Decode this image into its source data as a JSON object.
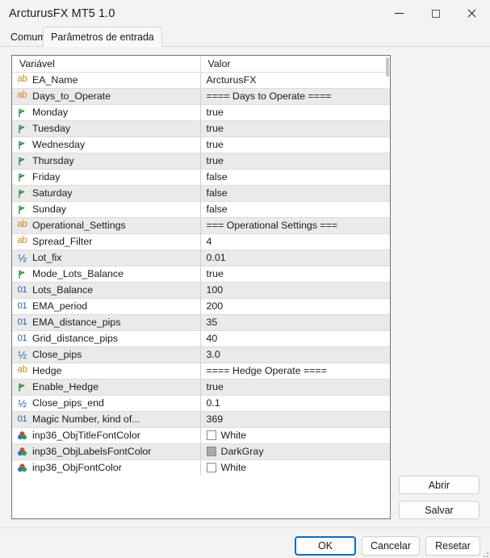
{
  "window": {
    "title": "ArcturusFX MT5 1.0",
    "controls": [
      {
        "name": "minimize",
        "glyph": "minimize-icon"
      },
      {
        "name": "maximize",
        "glyph": "maximize-icon"
      },
      {
        "name": "close",
        "glyph": "close-icon"
      }
    ]
  },
  "tabs": [
    {
      "label": "Comum",
      "active": false
    },
    {
      "label": "Parâmetros de entrada",
      "active": true
    }
  ],
  "table": {
    "headers": {
      "variable": "Variável",
      "value": "Valor"
    },
    "rows": [
      {
        "icon": "string-type-icon",
        "name": "EA_Name",
        "value": "ArcturusFX"
      },
      {
        "icon": "string-type-icon",
        "name": "Days_to_Operate",
        "value": "==== Days to Operate ===="
      },
      {
        "icon": "bool-type-icon",
        "name": "Monday",
        "value": "true"
      },
      {
        "icon": "bool-type-icon",
        "name": "Tuesday",
        "value": "true"
      },
      {
        "icon": "bool-type-icon",
        "name": "Wednesday",
        "value": "true"
      },
      {
        "icon": "bool-type-icon",
        "name": "Thursday",
        "value": "true"
      },
      {
        "icon": "bool-type-icon",
        "name": "Friday",
        "value": "false"
      },
      {
        "icon": "bool-type-icon",
        "name": "Saturday",
        "value": "false"
      },
      {
        "icon": "bool-type-icon",
        "name": "Sunday",
        "value": "false"
      },
      {
        "icon": "string-type-icon",
        "name": "Operational_Settings",
        "value": "=== Operational Settings ==="
      },
      {
        "icon": "string-type-icon",
        "name": "Spread_Filter",
        "value": "4"
      },
      {
        "icon": "double-type-icon",
        "name": "Lot_fix",
        "value": "0.01"
      },
      {
        "icon": "bool-type-icon",
        "name": "Mode_Lots_Balance",
        "value": "true"
      },
      {
        "icon": "int-type-icon",
        "name": "Lots_Balance",
        "value": "100"
      },
      {
        "icon": "int-type-icon",
        "name": "EMA_period",
        "value": "200"
      },
      {
        "icon": "int-type-icon",
        "name": "EMA_distance_pips",
        "value": "35"
      },
      {
        "icon": "int-type-icon",
        "name": "Grid_distance_pips",
        "value": "40"
      },
      {
        "icon": "double-type-icon",
        "name": "Close_pips",
        "value": "3.0"
      },
      {
        "icon": "string-type-icon",
        "name": "Hedge",
        "value": "==== Hedge Operate ===="
      },
      {
        "icon": "bool-type-icon",
        "name": "Enable_Hedge",
        "value": "true"
      },
      {
        "icon": "double-type-icon",
        "name": "Close_pips_end",
        "value": "0.1"
      },
      {
        "icon": "int-type-icon",
        "name": "Magic Number, kind of...",
        "value": "369"
      },
      {
        "icon": "color-type-icon",
        "name": "inp36_ObjTitleFontColor",
        "value": "White",
        "swatch": "#ffffff"
      },
      {
        "icon": "color-type-icon",
        "name": "inp36_ObjLabelsFontColor",
        "value": "DarkGray",
        "swatch": "#a9a9a9"
      },
      {
        "icon": "color-type-icon",
        "name": "inp36_ObjFontColor",
        "value": "White",
        "swatch": "#ffffff"
      }
    ]
  },
  "side_buttons": {
    "open": "Abrir",
    "save": "Salvar"
  },
  "footer_buttons": {
    "ok": "OK",
    "cancel": "Cancelar",
    "reset": "Resetar"
  },
  "colors": {
    "accent": "#0f6cbd",
    "string_icon": "#d08a22",
    "numeric_icon": "#1f5fa9",
    "bool_icon": "#2e8b3d",
    "row_alt": "#eaeaea",
    "panel_border": "#6f7478"
  }
}
